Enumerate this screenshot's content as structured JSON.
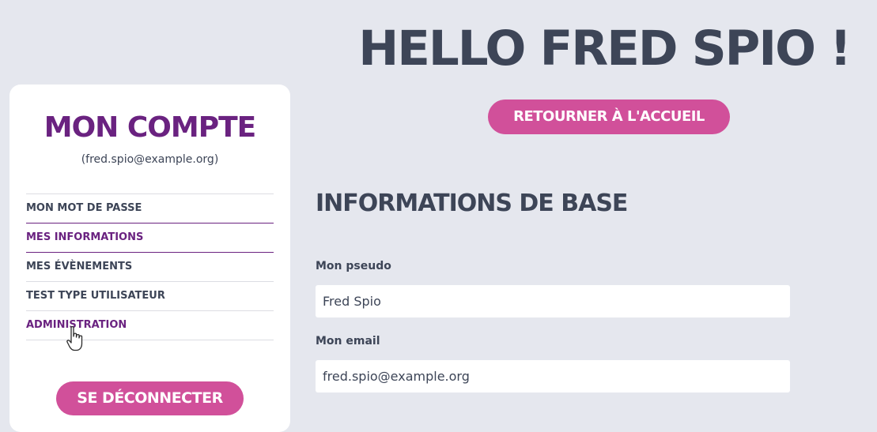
{
  "header": {
    "greeting": "HELLO FRED SPIO !",
    "home_button": "RETOURNER À L'ACCUEIL"
  },
  "sidebar": {
    "title": "MON COMPTE",
    "email": "(fred.spio@example.org)",
    "items": [
      {
        "label": "MON MOT DE PASSE"
      },
      {
        "label": "MES INFORMATIONS"
      },
      {
        "label": "MES ÉVÈNEMENTS"
      },
      {
        "label": "TEST TYPE UTILISATEUR"
      },
      {
        "label": "ADMINISTRATION"
      }
    ],
    "logout_button": "SE DÉCONNECTER"
  },
  "main": {
    "section_title": "INFORMATIONS DE BASE",
    "fields": [
      {
        "label": "Mon pseudo",
        "value": "Fred Spio"
      },
      {
        "label": "Mon email",
        "value": "fred.spio@example.org"
      }
    ]
  },
  "colors": {
    "background": "#e5e7ee",
    "brand_purple": "#6a2280",
    "button_pink": "#d1509a",
    "text_dark": "#3d4557"
  },
  "icons": {
    "cursor": "hand-pointer-icon"
  }
}
